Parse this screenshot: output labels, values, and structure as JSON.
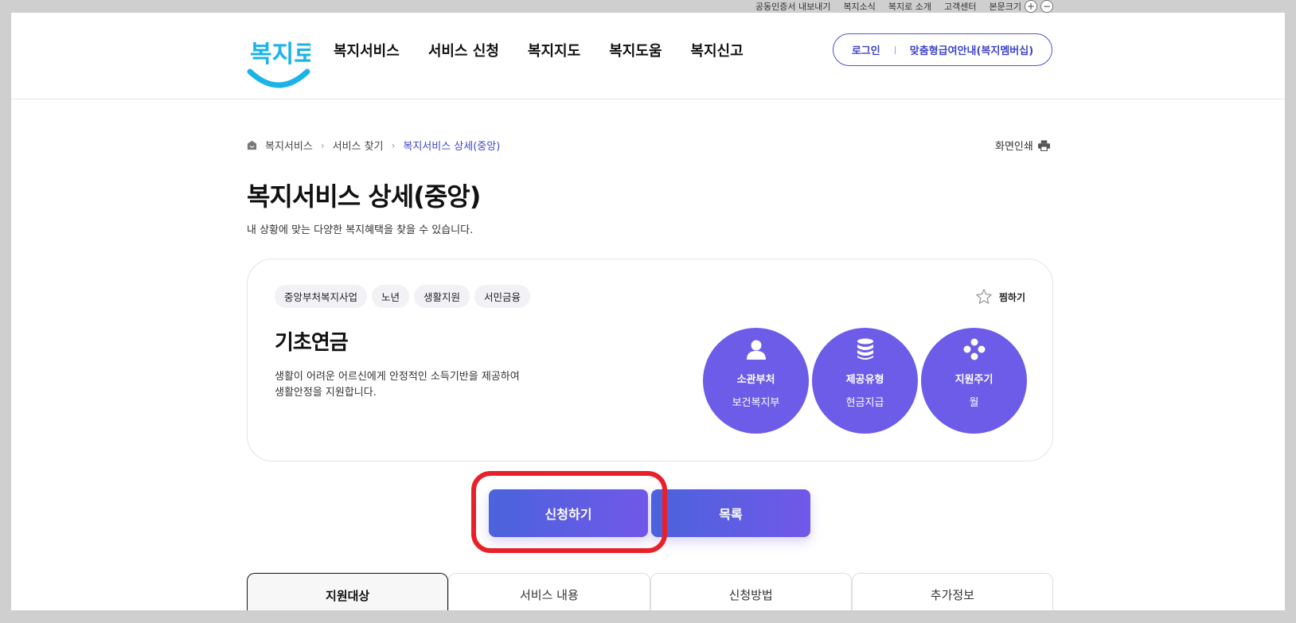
{
  "utility": {
    "cert_export": "공동인증서 내보내기",
    "news": "복지소식",
    "about": "복지로 소개",
    "support": "고객센터",
    "font_size": "본문크기",
    "zoom_in": "+",
    "zoom_out": "−"
  },
  "header": {
    "logo_text": "복지로",
    "nav": [
      "복지서비스",
      "서비스 신청",
      "복지지도",
      "복지도움",
      "복지신고"
    ],
    "login": "로그인",
    "membership": "맞춤형급여안내(복지멤버십)"
  },
  "breadcrumb": {
    "items": [
      "복지서비스",
      "서비스 찾기",
      "복지서비스 상세(중앙)"
    ],
    "print": "화면인쇄"
  },
  "page": {
    "title": "복지서비스 상세(중앙)",
    "subtitle": "내 상황에 맞는 다양한 복지혜택을 찾을 수 있습니다."
  },
  "service": {
    "tags": [
      "중앙부처복지사업",
      "노년",
      "생활지원",
      "서민금융"
    ],
    "bookmark": "찜하기",
    "name": "기초연금",
    "description": "생활이 어려운 어르신에게 안정적인 소득기반을 제공하여 생활안정을 지원합니다.",
    "info": [
      {
        "label": "소관부처",
        "value": "보건복지부",
        "icon": "person-icon"
      },
      {
        "label": "제공유형",
        "value": "현금지급",
        "icon": "coins-icon"
      },
      {
        "label": "지원주기",
        "value": "월",
        "icon": "cycle-icon"
      }
    ]
  },
  "actions": {
    "apply": "신청하기",
    "list": "목록"
  },
  "tabs": [
    "지원대상",
    "서비스 내용",
    "신청방법",
    "추가정보"
  ],
  "colors": {
    "accent": "#6d5ce8",
    "brand_blue": "#3f45c9",
    "highlight": "#e8202a",
    "logo_cyan": "#1bb3e8"
  }
}
